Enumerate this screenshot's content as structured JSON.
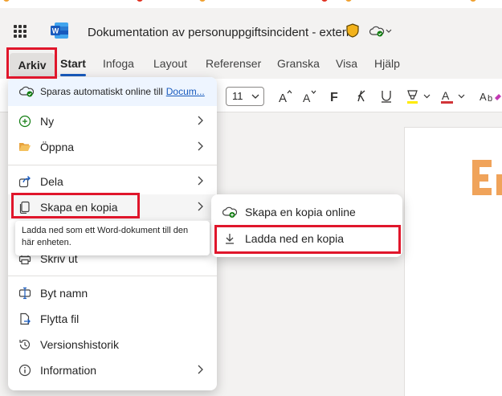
{
  "document": {
    "title": "Dokumentation av personuppgiftsincident - extern"
  },
  "ribbon": {
    "tabs": [
      "Arkiv",
      "Start",
      "Infoga",
      "Layout",
      "Referenser",
      "Granska",
      "Visa",
      "Hjälp"
    ],
    "font_size": "11"
  },
  "file_menu": {
    "autosave_text": "Sparas automatiskt online till",
    "autosave_link": "Docum...",
    "items": [
      {
        "label": "Ny"
      },
      {
        "label": "Öppna"
      },
      {
        "label": "Dela"
      },
      {
        "label": "Skapa en kopia"
      },
      {
        "label": "Skriv ut"
      },
      {
        "label": "Byt namn"
      },
      {
        "label": "Flytta fil"
      },
      {
        "label": "Versionshistorik"
      },
      {
        "label": "Information"
      }
    ]
  },
  "submenu": {
    "items": [
      {
        "label": "Skapa en kopia online"
      },
      {
        "label": "Ladda ned en kopia"
      }
    ]
  },
  "tooltip": {
    "text": "Ladda ned som ett Word-dokument till den här enheten."
  },
  "colors": {
    "accent": "#185abd",
    "highlight": "#e0162b",
    "brand_orange": "#f0a35a"
  }
}
